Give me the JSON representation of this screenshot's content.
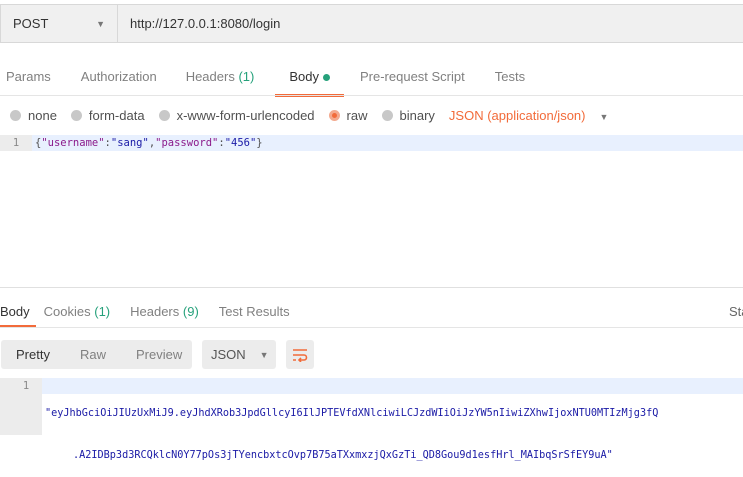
{
  "request": {
    "method": "POST",
    "url": "http://127.0.0.1:8080/login"
  },
  "request_tabs": {
    "params": "Params",
    "authorization": "Authorization",
    "headers": "Headers",
    "headers_count": "(1)",
    "body": "Body",
    "prerequest": "Pre-request Script",
    "tests": "Tests"
  },
  "body_types": {
    "none": "none",
    "form_data": "form-data",
    "urlencoded": "x-www-form-urlencoded",
    "raw": "raw",
    "binary": "binary",
    "content_type": "JSON (application/json)",
    "selected": "raw"
  },
  "request_body": {
    "line_number": "1",
    "open": "{",
    "k1": "\"username\"",
    "c1": ":",
    "v1": "\"sang\"",
    "comma": ",",
    "k2": "\"password\"",
    "c2": ":",
    "v2": "\"456\"",
    "close": "}"
  },
  "response_tabs": {
    "body": "Body",
    "cookies": "Cookies",
    "cookies_count": "(1)",
    "headers": "Headers",
    "headers_count": "(9)",
    "test_results": "Test Results",
    "status": "Sta"
  },
  "response_toolbar": {
    "pretty": "Pretty",
    "raw": "Raw",
    "preview": "Preview",
    "format": "JSON"
  },
  "response_body": {
    "line_number": "1",
    "line1": "\"eyJhbGciOiJIUzUxMiJ9.eyJhdXRob3JpdGllcyI6IlJPTEVfdXNlciwiLCJzdWIiOiJzYW5nIiwiZXhwIjoxNTU0MTIzMjg3fQ",
    "line2": ".A2IDBp3d3RCQklcN0Y77pOs3jTYencbxtcOvp7B75aTXxmxzjQxGzTi_QD8Gou9d1esfHrl_MAIbqSrSfEY9uA\""
  },
  "colors": {
    "accent": "#f26b3a",
    "green": "#26a17b"
  }
}
